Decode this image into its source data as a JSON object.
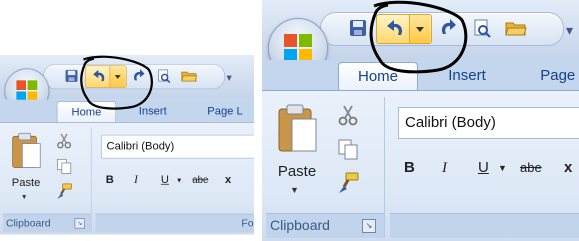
{
  "tabs": [
    "Home",
    "Insert",
    "Page L"
  ],
  "font": {
    "name": "Calibri (Body)"
  },
  "format_buttons": [
    "B",
    "I",
    "U",
    "abe",
    "x"
  ],
  "clipboard": {
    "paste_label": "Paste",
    "group_label": "Clipboard"
  },
  "font_group_label": "Fo",
  "icons": [
    "office-orb",
    "save-icon",
    "undo-icon",
    "undo-dropdown-icon",
    "redo-icon",
    "print-preview-icon",
    "open-folder-icon",
    "cut-icon",
    "copy-icon",
    "format-painter-icon",
    "paste-icon"
  ],
  "colors": {
    "undo_highlight": "#ffd86d",
    "tab_text": "#15428b",
    "ink_circle": "#000000"
  }
}
